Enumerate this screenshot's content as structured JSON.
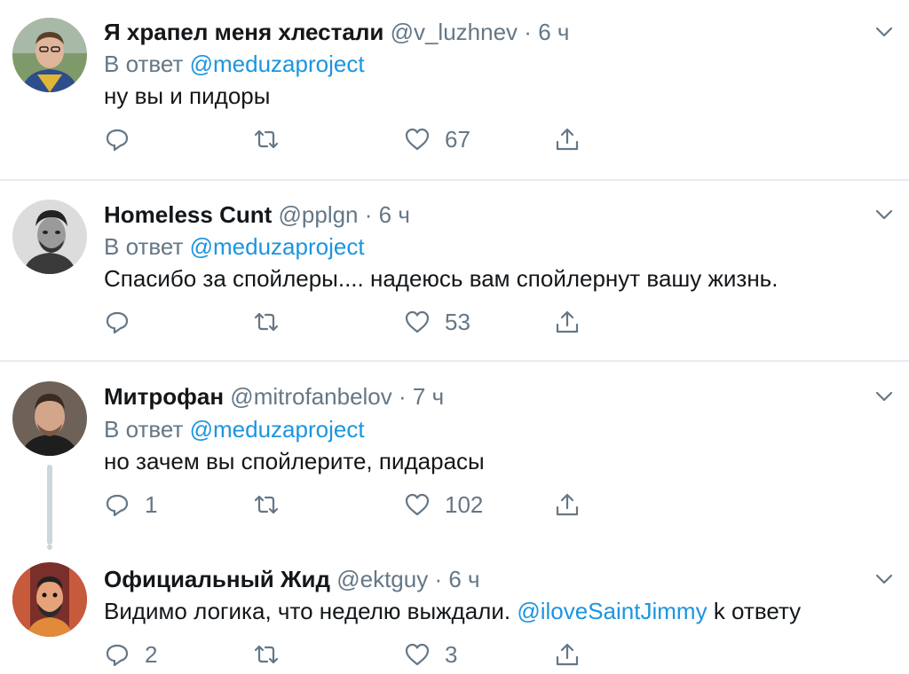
{
  "tweets": [
    {
      "name": "Я храпел меня хлестали",
      "handle": "@v_luzhnev",
      "dot": "·",
      "time": "6 ч",
      "reply_prefix": "В ответ",
      "reply_to": "@meduzaproject",
      "text": "ну вы и пидоры",
      "replies": "",
      "retweets": "",
      "likes": "67"
    },
    {
      "name": "Homeless Cunt",
      "handle": "@pplgn",
      "dot": "·",
      "time": "6 ч",
      "reply_prefix": "В ответ",
      "reply_to": "@meduzaproject",
      "text": "Спасибо за спойлеры.... надеюсь вам спойлернут вашу жизнь.",
      "replies": "",
      "retweets": "",
      "likes": "53"
    },
    {
      "name": "Митрофан",
      "handle": "@mitrofanbelov",
      "dot": "·",
      "time": "7 ч",
      "reply_prefix": "В ответ",
      "reply_to": "@meduzaproject",
      "text": "но зачем вы спойлерите, пидарасы",
      "replies": "1",
      "retweets": "",
      "likes": "102"
    },
    {
      "name": "Официальный Жид",
      "handle": "@ektguy",
      "dot": "·",
      "time": "6 ч",
      "text_before": "Видимо логика, что неделю выждали.",
      "mention": "@iloveSaintJimmy",
      "text_after": "k ответу",
      "replies": "2",
      "retweets": "",
      "likes": "3"
    }
  ],
  "icons": {
    "reply": "reply-icon",
    "retweet": "retweet-icon",
    "like": "heart-icon",
    "share": "share-icon",
    "more": "chevron-down-icon"
  },
  "colors": {
    "link": "#1b95e0",
    "secondary": "#657786",
    "separator": "#e6ecf0",
    "thread_line": "#ccd6dd"
  }
}
